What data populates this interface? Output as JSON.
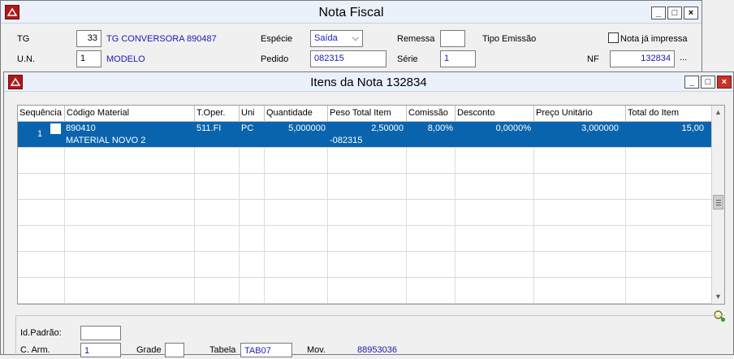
{
  "nota_fiscal": {
    "title": "Nota Fiscal",
    "tg_label": "TG",
    "tg_code": "33",
    "tg_name": "TG CONVERSORA 890487",
    "especie_label": "Espécie",
    "especie_value": "Saída",
    "remessa_label": "Remessa",
    "remessa_value": "",
    "tipo_emissao_label": "Tipo Emissão",
    "impressa_label": "Nota já impressa",
    "un_label": "U.N.",
    "un_code": "1",
    "un_name": "MODELO",
    "pedido_label": "Pedido",
    "pedido_value": "082315",
    "serie_label": "Série",
    "serie_value": "1",
    "nf_label": "NF",
    "nf_value": "132834",
    "ellipsis": "..."
  },
  "itens": {
    "title": "Itens da Nota 132834",
    "columns": [
      "Sequência",
      "Código Material",
      "T.Oper.",
      "Uni",
      "Quantidade",
      "Peso Total Item",
      "Comissão",
      "Desconto",
      "Preço Unitário",
      "Total do Item"
    ],
    "row": {
      "seq": "1",
      "codigo": "890410",
      "material": "MATERIAL NOVO 2",
      "toper": "511.FI",
      "uni": "PC",
      "quantidade": "5,000000",
      "peso": "2,50000",
      "peso_sub": "-082315",
      "comissao": "8,00%",
      "desconto": "0,0000%",
      "preco": "3,000000",
      "total": "15,00"
    }
  },
  "bottom": {
    "idpadrao_label": "Id.Padrão:",
    "idpadrao_value": "",
    "carm_label": "C. Arm.",
    "carm_value": "1",
    "grade_label": "Grade",
    "grade_value": "",
    "tabela_label": "Tabela",
    "tabela_value": "TAB07",
    "mov_label": "Mov.",
    "mov_value": "88953036"
  },
  "colors": {
    "selection": "#0a64ad",
    "titlebar": "#eaf1fb",
    "value_blue": "#1a1ab4"
  }
}
